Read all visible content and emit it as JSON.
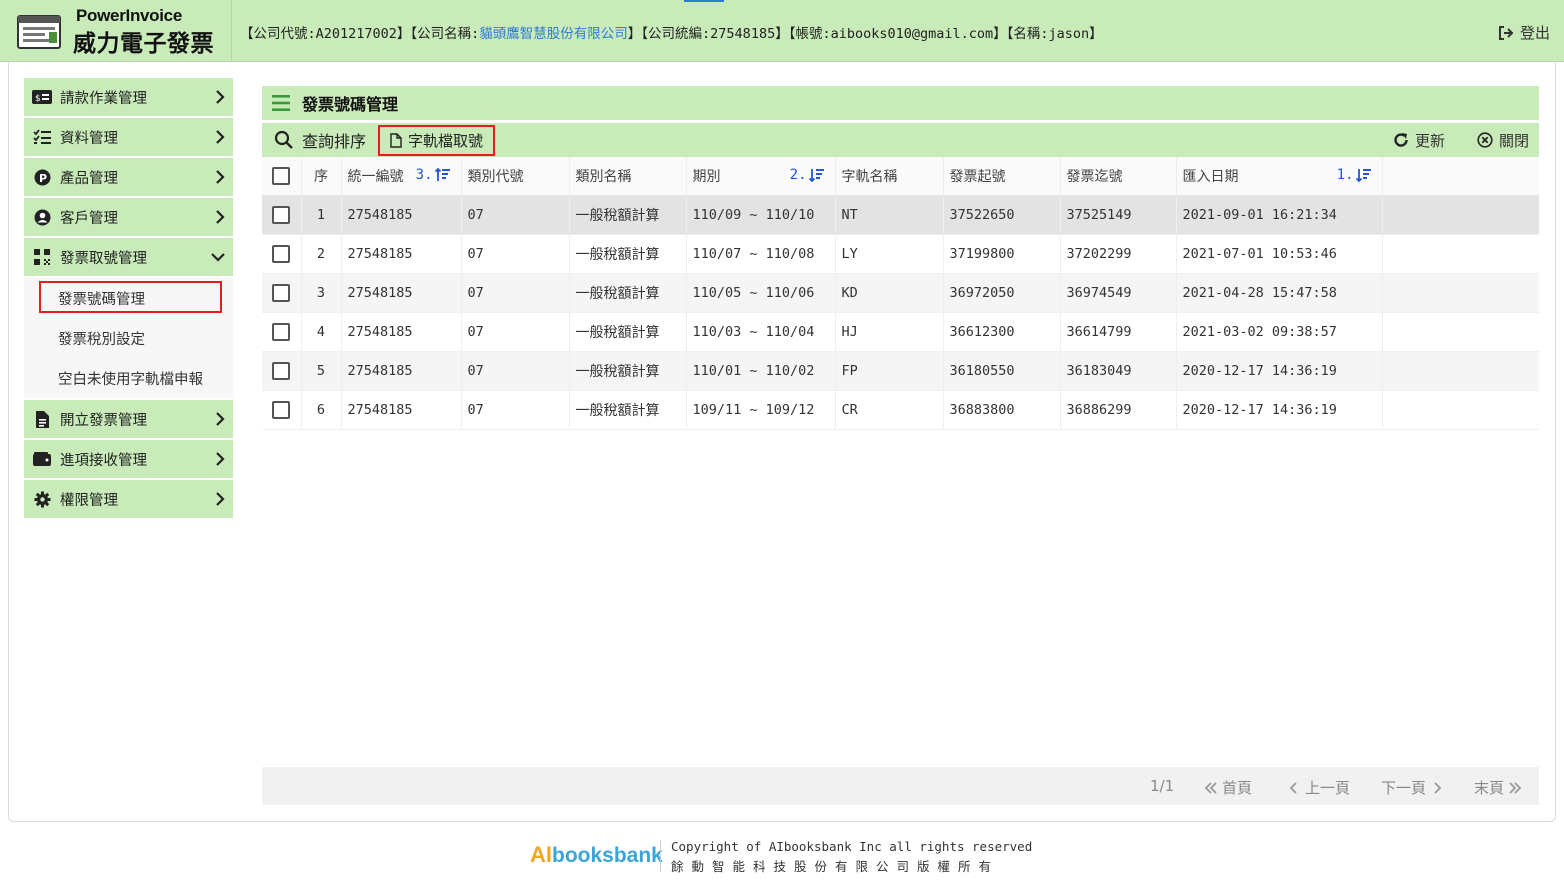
{
  "header": {
    "logo_en": "PowerInvoice",
    "logo_zh": "威力電子發票",
    "info_prefix": "【公司代號:A201217002】【公司名稱:",
    "company_name": "貓頭鷹智慧股份有限公司",
    "info_suffix": "】【公司統編:27548185】【帳號:aibooks010@gmail.com】【名稱:jason】",
    "logout_label": "登出"
  },
  "sidebar": {
    "items": [
      {
        "label": "請款作業管理",
        "icon": "money-card-icon"
      },
      {
        "label": "資料管理",
        "icon": "list-check-icon"
      },
      {
        "label": "產品管理",
        "icon": "product-p-icon"
      },
      {
        "label": "客戶管理",
        "icon": "user-circle-icon"
      },
      {
        "label": "發票取號管理",
        "icon": "qrcode-icon"
      },
      {
        "label": "開立發票管理",
        "icon": "invoice-file-icon"
      },
      {
        "label": "進項接收管理",
        "icon": "wallet-icon"
      },
      {
        "label": "權限管理",
        "icon": "gear-icon"
      }
    ],
    "sub_items": [
      "發票號碼管理",
      "發票稅別設定",
      "空白未使用字軌檔申報"
    ]
  },
  "main": {
    "title": "發票號碼管理",
    "toolbar": {
      "query_label": "查詢排序",
      "track_label": "字軌檔取號",
      "refresh_label": "更新",
      "close_label": "關閉"
    },
    "columns": [
      "序",
      "統一編號",
      "類別代號",
      "類別名稱",
      "期別",
      "字軌名稱",
      "發票起號",
      "發票迄號",
      "匯入日期"
    ],
    "sort_marks": {
      "tax_id": "3.",
      "period": "2.",
      "import_date": "1."
    },
    "rows": [
      [
        "1",
        "27548185",
        "07",
        "一般稅額計算",
        "110/09 ~ 110/10",
        "NT",
        "37522650",
        "37525149",
        "2021-09-01 16:21:34"
      ],
      [
        "2",
        "27548185",
        "07",
        "一般稅額計算",
        "110/07 ~ 110/08",
        "LY",
        "37199800",
        "37202299",
        "2021-07-01 10:53:46"
      ],
      [
        "3",
        "27548185",
        "07",
        "一般稅額計算",
        "110/05 ~ 110/06",
        "KD",
        "36972050",
        "36974549",
        "2021-04-28 15:47:58"
      ],
      [
        "4",
        "27548185",
        "07",
        "一般稅額計算",
        "110/03 ~ 110/04",
        "HJ",
        "36612300",
        "36614799",
        "2021-03-02 09:38:57"
      ],
      [
        "5",
        "27548185",
        "07",
        "一般稅額計算",
        "110/01 ~ 110/02",
        "FP",
        "36180550",
        "36183049",
        "2020-12-17 14:36:19"
      ],
      [
        "6",
        "27548185",
        "07",
        "一般稅額計算",
        "109/11 ~ 109/12",
        "CR",
        "36883800",
        "36886299",
        "2020-12-17 14:36:19"
      ]
    ]
  },
  "pager": {
    "page_info": "1/1",
    "first": "首頁",
    "prev": "上一頁",
    "next": "下一頁",
    "last": "末頁"
  },
  "footer": {
    "logo_ai": "AI",
    "logo_rest": "booksbank",
    "copyright_en": "Copyright of AIbooksbank Inc all rights reserved",
    "copyright_zh": "餘動智能科技股份有限公司版權所有"
  },
  "colors": {
    "header_bg": "#c8ebb9",
    "accent_link": "#2f7bd3",
    "highlight_border": "#e02020",
    "sort_blue": "#2355d6"
  }
}
